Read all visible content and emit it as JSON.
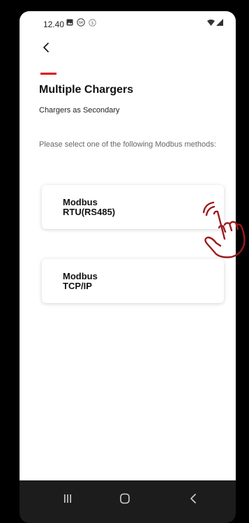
{
  "status_bar": {
    "time": "12.40",
    "icons_left": [
      "image-icon",
      "data-64-icon",
      "currency-icon"
    ],
    "icons_right": [
      "wifi-icon",
      "signal-icon"
    ]
  },
  "header": {
    "back_icon": "chevron-left-icon",
    "title": "Multiple Chargers",
    "subtitle": "Chargers as Secondary",
    "accent_color": "#e30613"
  },
  "main": {
    "instruction": "Please select one of the following Modbus methods:",
    "options": [
      {
        "label": "Modbus\nRTU(RS485)"
      },
      {
        "label": "Modbus\nTCP/IP"
      }
    ]
  },
  "overlay": {
    "pointer_icon": "tap-hand-icon",
    "pointer_color": "#9b1b1f"
  },
  "nav_bar": {
    "icons": [
      "recent-apps-icon",
      "home-icon",
      "back-icon"
    ]
  }
}
